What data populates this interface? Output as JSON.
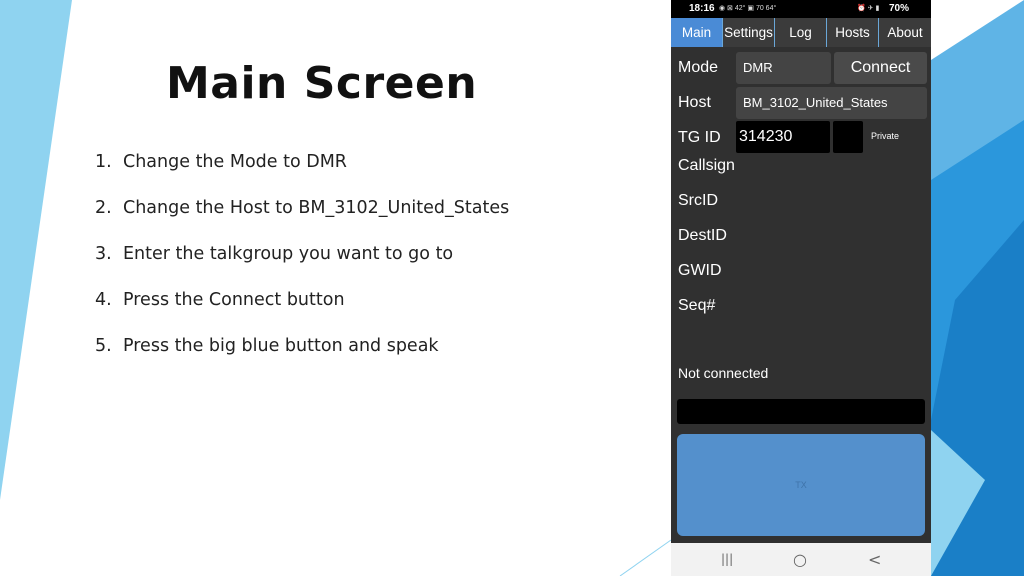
{
  "slide": {
    "title": "Main Screen",
    "steps": [
      {
        "num": "1.",
        "text": "Change the Mode to DMR"
      },
      {
        "num": "2.",
        "text": "Change the Host to BM_3102_United_States"
      },
      {
        "num": "3.",
        "text": "Enter the talkgroup you want to go to"
      },
      {
        "num": "4.",
        "text": "Press the Connect button"
      },
      {
        "num": "5.",
        "text": "Press the big blue button and speak"
      }
    ]
  },
  "status_bar": {
    "time": "18:16",
    "left_icons": "◉ ⊠ 42° ▣ 70 64°",
    "right_icons": "⏰ ✈ ▮",
    "battery": "70%"
  },
  "tabs": [
    {
      "label": "Main",
      "active": true
    },
    {
      "label": "Settings",
      "active": false
    },
    {
      "label": "Log",
      "active": false
    },
    {
      "label": "Hosts",
      "active": false
    },
    {
      "label": "About",
      "active": false
    }
  ],
  "form": {
    "mode_label": "Mode",
    "mode_value": "DMR",
    "connect_label": "Connect",
    "host_label": "Host",
    "host_value": "BM_3102_United_States",
    "tgid_label": "TG ID",
    "tgid_value": "314230",
    "private_label": "Private",
    "callsign_label": "Callsign",
    "srcid_label": "SrcID",
    "destid_label": "DestID",
    "gwid_label": "GWID",
    "seq_label": "Seq#"
  },
  "connection_status": "Not connected",
  "tx_button_label": "TX",
  "nav": {
    "recents": "|||",
    "home": "○",
    "back": "<"
  },
  "colors": {
    "accent": "#4a8bd6",
    "tx_button": "#5490cc",
    "phone_bg": "#303030",
    "deco_light_blue": "#8fd3f0",
    "deco_blue": "#1e88d8"
  }
}
